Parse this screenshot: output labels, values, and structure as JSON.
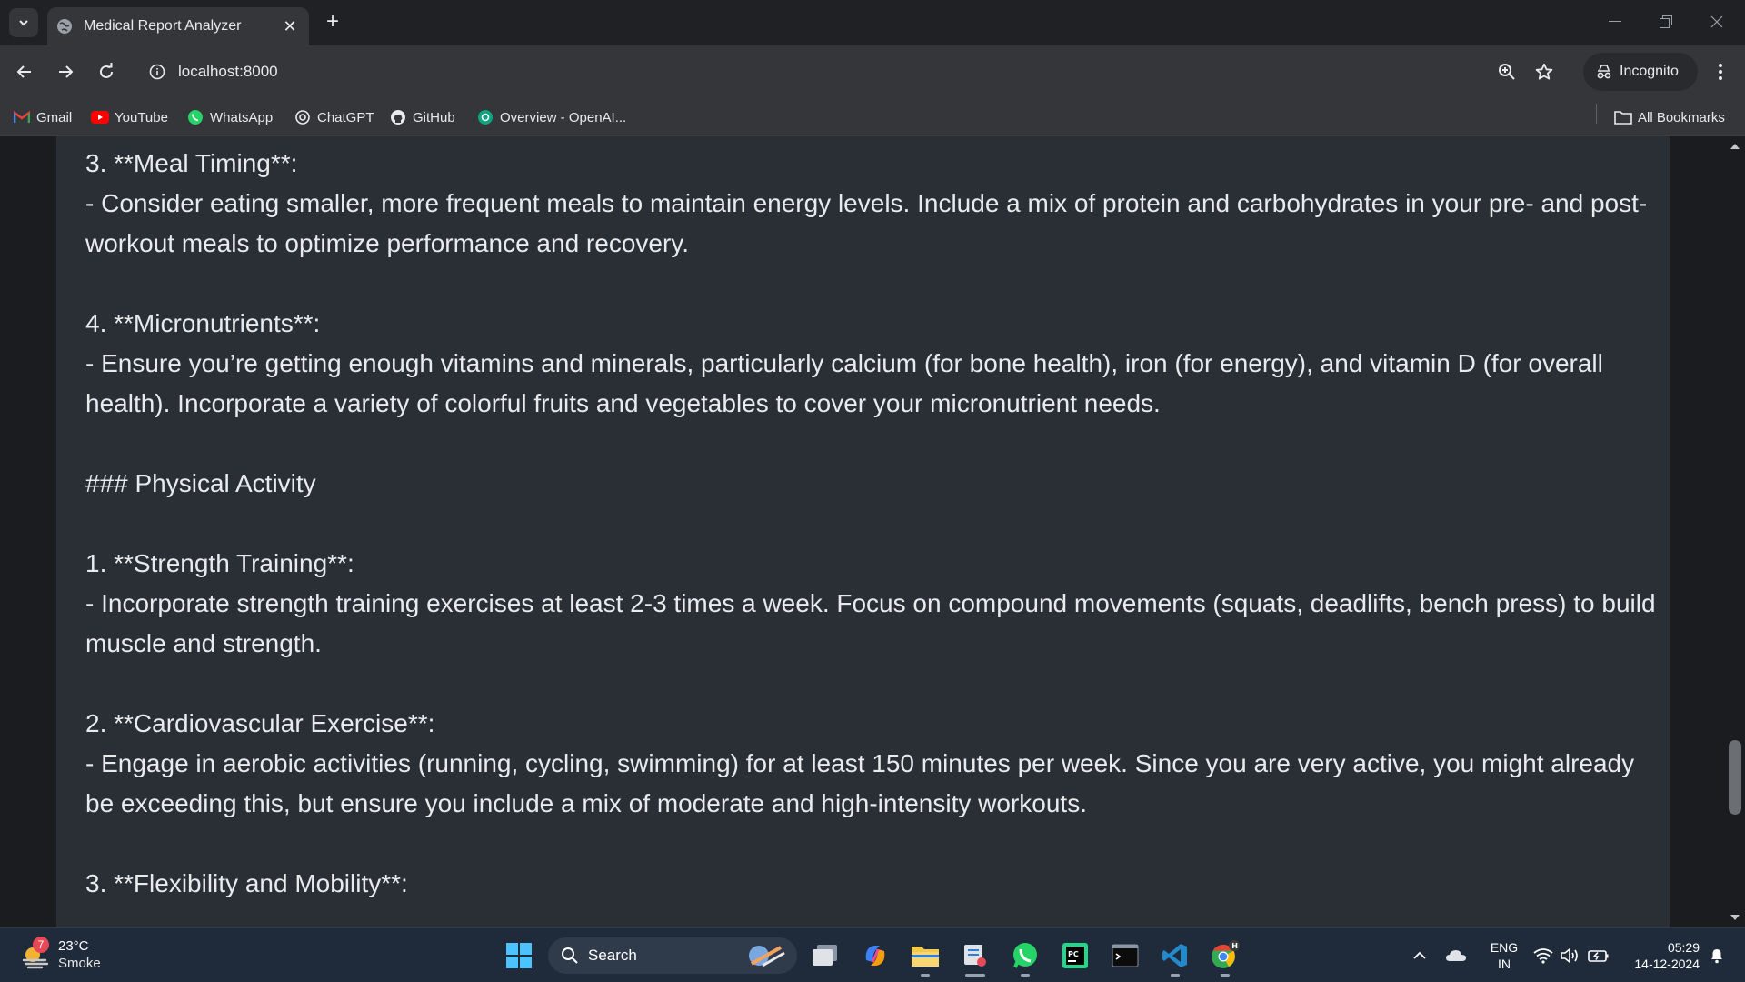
{
  "browser": {
    "tab_title": "Medical Report Analyzer",
    "new_tab_label": "+",
    "close_label": "✕",
    "url": "localhost:8000",
    "incognito_label": "Incognito"
  },
  "bookmarks": {
    "items": [
      {
        "label": "Gmail",
        "icon": "gmail-icon",
        "color": "#ea4335"
      },
      {
        "label": "YouTube",
        "icon": "youtube-icon",
        "color": "#ff0000"
      },
      {
        "label": "WhatsApp",
        "icon": "whatsapp-icon",
        "color": "#25d366"
      },
      {
        "label": "ChatGPT",
        "icon": "chatgpt-icon",
        "color": "#e8eaed"
      },
      {
        "label": "GitHub",
        "icon": "github-icon",
        "color": "#e8eaed"
      },
      {
        "label": "Overview - OpenAI...",
        "icon": "openai-icon",
        "color": "#10a37f"
      }
    ],
    "all_bookmarks_label": "All Bookmarks"
  },
  "content": {
    "lines": [
      "3. **Meal Timing**:",
      "- Consider eating smaller, more frequent meals to maintain energy levels. Include a mix of protein and carbohydrates in your pre- and post-",
      "workout meals to optimize performance and recovery.",
      "",
      "4. **Micronutrients**:",
      "- Ensure you’re getting enough vitamins and minerals, particularly calcium (for bone health), iron (for energy), and vitamin D (for overall",
      "health). Incorporate a variety of colorful fruits and vegetables to cover your micronutrient needs.",
      "",
      "### Physical Activity",
      "",
      "1. **Strength Training**:",
      "- Incorporate strength training exercises at least 2-3 times a week. Focus on compound movements (squats, deadlifts, bench press) to build",
      "muscle and strength.",
      "",
      "2. **Cardiovascular Exercise**:",
      "- Engage in aerobic activities (running, cycling, swimming) for at least 150 minutes per week. Since you are very active, you might already",
      "be exceeding this, but ensure you include a mix of moderate and high-intensity workouts.",
      "",
      "3. **Flexibility and Mobility**:"
    ]
  },
  "taskbar": {
    "weather_badge": "7",
    "temperature": "23°C",
    "condition": "Smoke",
    "search_label": "Search",
    "lang_top": "ENG",
    "lang_bottom": "IN",
    "time": "05:29",
    "date": "14-12-2024",
    "chrome_badge": "H"
  },
  "colors": {
    "page_bg": "#1b1c20",
    "card_bg": "#2a2e35",
    "text": "#e8eaed",
    "taskbar_bg": "#1f2a3a"
  }
}
